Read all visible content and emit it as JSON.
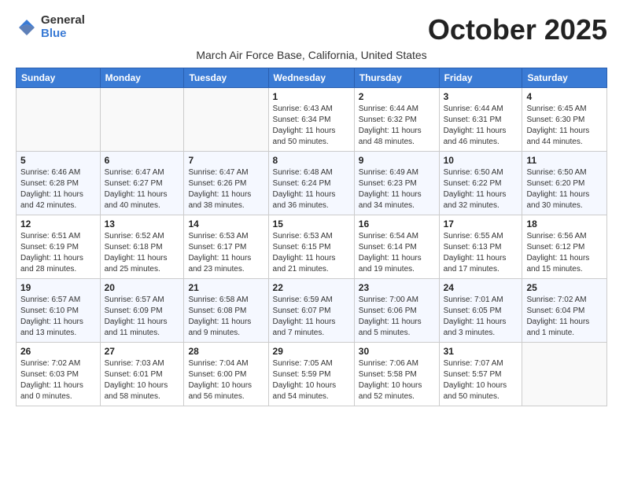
{
  "header": {
    "logo_general": "General",
    "logo_blue": "Blue",
    "month": "October 2025",
    "location": "March Air Force Base, California, United States"
  },
  "days_of_week": [
    "Sunday",
    "Monday",
    "Tuesday",
    "Wednesday",
    "Thursday",
    "Friday",
    "Saturday"
  ],
  "weeks": [
    [
      {
        "day": "",
        "info": ""
      },
      {
        "day": "",
        "info": ""
      },
      {
        "day": "",
        "info": ""
      },
      {
        "day": "1",
        "info": "Sunrise: 6:43 AM\nSunset: 6:34 PM\nDaylight: 11 hours\nand 50 minutes."
      },
      {
        "day": "2",
        "info": "Sunrise: 6:44 AM\nSunset: 6:32 PM\nDaylight: 11 hours\nand 48 minutes."
      },
      {
        "day": "3",
        "info": "Sunrise: 6:44 AM\nSunset: 6:31 PM\nDaylight: 11 hours\nand 46 minutes."
      },
      {
        "day": "4",
        "info": "Sunrise: 6:45 AM\nSunset: 6:30 PM\nDaylight: 11 hours\nand 44 minutes."
      }
    ],
    [
      {
        "day": "5",
        "info": "Sunrise: 6:46 AM\nSunset: 6:28 PM\nDaylight: 11 hours\nand 42 minutes."
      },
      {
        "day": "6",
        "info": "Sunrise: 6:47 AM\nSunset: 6:27 PM\nDaylight: 11 hours\nand 40 minutes."
      },
      {
        "day": "7",
        "info": "Sunrise: 6:47 AM\nSunset: 6:26 PM\nDaylight: 11 hours\nand 38 minutes."
      },
      {
        "day": "8",
        "info": "Sunrise: 6:48 AM\nSunset: 6:24 PM\nDaylight: 11 hours\nand 36 minutes."
      },
      {
        "day": "9",
        "info": "Sunrise: 6:49 AM\nSunset: 6:23 PM\nDaylight: 11 hours\nand 34 minutes."
      },
      {
        "day": "10",
        "info": "Sunrise: 6:50 AM\nSunset: 6:22 PM\nDaylight: 11 hours\nand 32 minutes."
      },
      {
        "day": "11",
        "info": "Sunrise: 6:50 AM\nSunset: 6:20 PM\nDaylight: 11 hours\nand 30 minutes."
      }
    ],
    [
      {
        "day": "12",
        "info": "Sunrise: 6:51 AM\nSunset: 6:19 PM\nDaylight: 11 hours\nand 28 minutes."
      },
      {
        "day": "13",
        "info": "Sunrise: 6:52 AM\nSunset: 6:18 PM\nDaylight: 11 hours\nand 25 minutes."
      },
      {
        "day": "14",
        "info": "Sunrise: 6:53 AM\nSunset: 6:17 PM\nDaylight: 11 hours\nand 23 minutes."
      },
      {
        "day": "15",
        "info": "Sunrise: 6:53 AM\nSunset: 6:15 PM\nDaylight: 11 hours\nand 21 minutes."
      },
      {
        "day": "16",
        "info": "Sunrise: 6:54 AM\nSunset: 6:14 PM\nDaylight: 11 hours\nand 19 minutes."
      },
      {
        "day": "17",
        "info": "Sunrise: 6:55 AM\nSunset: 6:13 PM\nDaylight: 11 hours\nand 17 minutes."
      },
      {
        "day": "18",
        "info": "Sunrise: 6:56 AM\nSunset: 6:12 PM\nDaylight: 11 hours\nand 15 minutes."
      }
    ],
    [
      {
        "day": "19",
        "info": "Sunrise: 6:57 AM\nSunset: 6:10 PM\nDaylight: 11 hours\nand 13 minutes."
      },
      {
        "day": "20",
        "info": "Sunrise: 6:57 AM\nSunset: 6:09 PM\nDaylight: 11 hours\nand 11 minutes."
      },
      {
        "day": "21",
        "info": "Sunrise: 6:58 AM\nSunset: 6:08 PM\nDaylight: 11 hours\nand 9 minutes."
      },
      {
        "day": "22",
        "info": "Sunrise: 6:59 AM\nSunset: 6:07 PM\nDaylight: 11 hours\nand 7 minutes."
      },
      {
        "day": "23",
        "info": "Sunrise: 7:00 AM\nSunset: 6:06 PM\nDaylight: 11 hours\nand 5 minutes."
      },
      {
        "day": "24",
        "info": "Sunrise: 7:01 AM\nSunset: 6:05 PM\nDaylight: 11 hours\nand 3 minutes."
      },
      {
        "day": "25",
        "info": "Sunrise: 7:02 AM\nSunset: 6:04 PM\nDaylight: 11 hours\nand 1 minute."
      }
    ],
    [
      {
        "day": "26",
        "info": "Sunrise: 7:02 AM\nSunset: 6:03 PM\nDaylight: 11 hours\nand 0 minutes."
      },
      {
        "day": "27",
        "info": "Sunrise: 7:03 AM\nSunset: 6:01 PM\nDaylight: 10 hours\nand 58 minutes."
      },
      {
        "day": "28",
        "info": "Sunrise: 7:04 AM\nSunset: 6:00 PM\nDaylight: 10 hours\nand 56 minutes."
      },
      {
        "day": "29",
        "info": "Sunrise: 7:05 AM\nSunset: 5:59 PM\nDaylight: 10 hours\nand 54 minutes."
      },
      {
        "day": "30",
        "info": "Sunrise: 7:06 AM\nSunset: 5:58 PM\nDaylight: 10 hours\nand 52 minutes."
      },
      {
        "day": "31",
        "info": "Sunrise: 7:07 AM\nSunset: 5:57 PM\nDaylight: 10 hours\nand 50 minutes."
      },
      {
        "day": "",
        "info": ""
      }
    ]
  ]
}
